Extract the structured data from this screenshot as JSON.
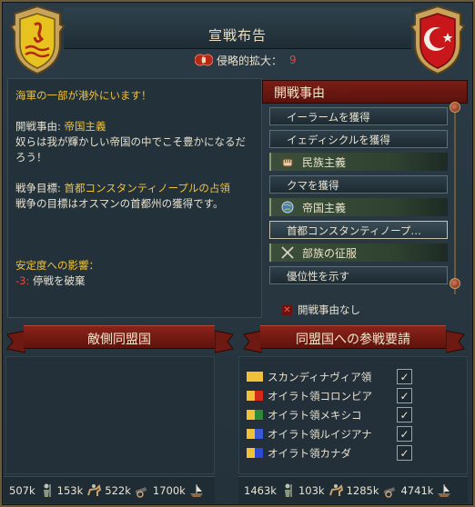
{
  "title": "宣戦布告",
  "aggressive_expansion": {
    "label": "侵略的拡大：",
    "value": "9"
  },
  "description": {
    "alert": "海軍の一部が港外にいます！",
    "cb_label": "開戦事由:",
    "cb_value": "帝国主義",
    "cb_flavor": "奴らは我が輝かしい帝国の中でこそ豊かになるだろう！",
    "wargoal_label": "戦争目標:",
    "wargoal_value": "首都コンスタンティノープルの占領",
    "wargoal_desc": "戦争の目標はオスマンの首都州の獲得です。",
    "stability_label": "安定度への影響：",
    "stability_value": "-3:",
    "stability_desc": "停戦を破棄"
  },
  "cb_panel": {
    "header": "開戦事由",
    "items": [
      {
        "kind": "button",
        "label": "イーラームを獲得"
      },
      {
        "kind": "button",
        "label": "イェディシクルを獲得"
      },
      {
        "kind": "group",
        "label": "民族主義",
        "icon": "fist-icon"
      },
      {
        "kind": "button",
        "label": "クマを獲得"
      },
      {
        "kind": "group",
        "label": "帝国主義",
        "icon": "globe-icon"
      },
      {
        "kind": "button",
        "label": "首都コンスタンティノープ…"
      },
      {
        "kind": "group",
        "label": "部族の征服",
        "icon": "crossed-swords-icon"
      },
      {
        "kind": "button",
        "label": "優位性を示す"
      }
    ],
    "none_label": "開戦事由なし"
  },
  "enemy_allies": {
    "title": "敵側同盟国"
  },
  "call_allies": {
    "title": "同盟国への参戦要請",
    "items": [
      {
        "name": "スカンディナヴィア領",
        "flag": [
          "#f0c23a",
          "#f0c23a"
        ],
        "checked": true
      },
      {
        "name": "オイラト領コロンビア",
        "flag": [
          "#f0c23a",
          "#d42a1a"
        ],
        "checked": true
      },
      {
        "name": "オイラト領メキシコ",
        "flag": [
          "#f0c23a",
          "#2a8a3a"
        ],
        "checked": true
      },
      {
        "name": "オイラト領ルイジアナ",
        "flag": [
          "#f0c23a",
          "#3a5ad4"
        ],
        "checked": true
      },
      {
        "name": "オイラト領カナダ",
        "flag": [
          "#f0c23a",
          "#2a4ad4"
        ],
        "checked": true
      }
    ]
  },
  "stats_left": [
    {
      "value": "507k",
      "icon": "infantry-icon"
    },
    {
      "value": "153k",
      "icon": "cavalry-icon"
    },
    {
      "value": "522k",
      "icon": "artillery-icon"
    },
    {
      "value": "1700k",
      "icon": "ships-icon"
    }
  ],
  "stats_right": [
    {
      "value": "1463k",
      "icon": "infantry-icon"
    },
    {
      "value": "103k",
      "icon": "cavalry-icon"
    },
    {
      "value": "1285k",
      "icon": "artillery-icon"
    },
    {
      "value": "4741k",
      "icon": "ships-icon"
    }
  ],
  "colors": {
    "accent_red": "#7a1e16",
    "highlight_yellow": "#f0c23a",
    "negative_red": "#e04a3a"
  }
}
